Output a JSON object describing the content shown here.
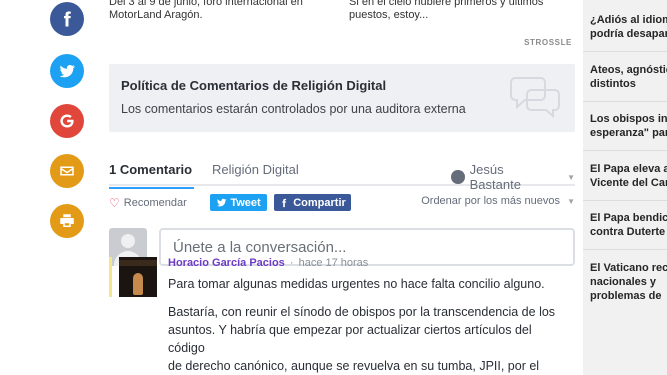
{
  "share": {
    "facebook_icon": "facebook-icon",
    "twitter_icon": "twitter-icon",
    "google_icon": "google-icon",
    "mail_icon": "mail-icon",
    "print_icon": "print-icon"
  },
  "related": {
    "left_line1": "Del 3 al 9 de junio, foro internacional en",
    "left_line2": "MotorLand Aragón.",
    "right_line1": "Si en el cielo hubiere primeros y últimos",
    "right_line2": "puestos, estoy...",
    "provider": "STROSSLE"
  },
  "policy": {
    "title": "Política de Comentarios de Religión Digital",
    "text": "Los comentarios estarán controlados por una auditora externa"
  },
  "tabs": {
    "comments": "1 Comentario",
    "site": "Religión Digital",
    "user": "Jesús Bastante"
  },
  "actions": {
    "recommend": "Recomendar",
    "tweet": "Tweet",
    "share": "Compartir",
    "sort": "Ordenar por los más nuevos"
  },
  "compose": {
    "placeholder": "Únete a la conversación..."
  },
  "comment": {
    "author": "Horacio García Pacios",
    "time": "hace 17 horas",
    "p1": "Para tomar algunas medidas urgentes no hace falta concilio alguno.",
    "p2_line1": "Bastaría, con reunir el sínodo de obispos por la transcendencia de los",
    "p2_line2": "asuntos. Y habría que empezar por actualizar ciertos artículos del código",
    "p2_line3": "de derecho canónico, aunque se revuelva en su tumba, JPII, por el tema"
  },
  "sidebar": {
    "items": [
      {
        "l1": "¿Adiós al idioma",
        "l2": "podría desaparecer"
      },
      {
        "l1": "Ateos, agnósticos",
        "l2": "distintos"
      },
      {
        "l1": "Los obispos insisten",
        "l2": "esperanza\" para"
      },
      {
        "l1": "El Papa eleva a",
        "l2": "Vicente del Campo"
      },
      {
        "l1": "El Papa bendice",
        "l2": "contra Duterte"
      },
      {
        "l1": "El Vaticano reconoce",
        "l2": "nacionales y",
        "l3": "problemas de"
      }
    ]
  },
  "colors": {
    "facebook": "#3b5998",
    "twitter": "#1da1f2",
    "google": "#e0463a",
    "mail": "#e39b17",
    "print": "#e39b17",
    "accent_tab": "#2e9fff",
    "author": "#6e3bc5"
  }
}
